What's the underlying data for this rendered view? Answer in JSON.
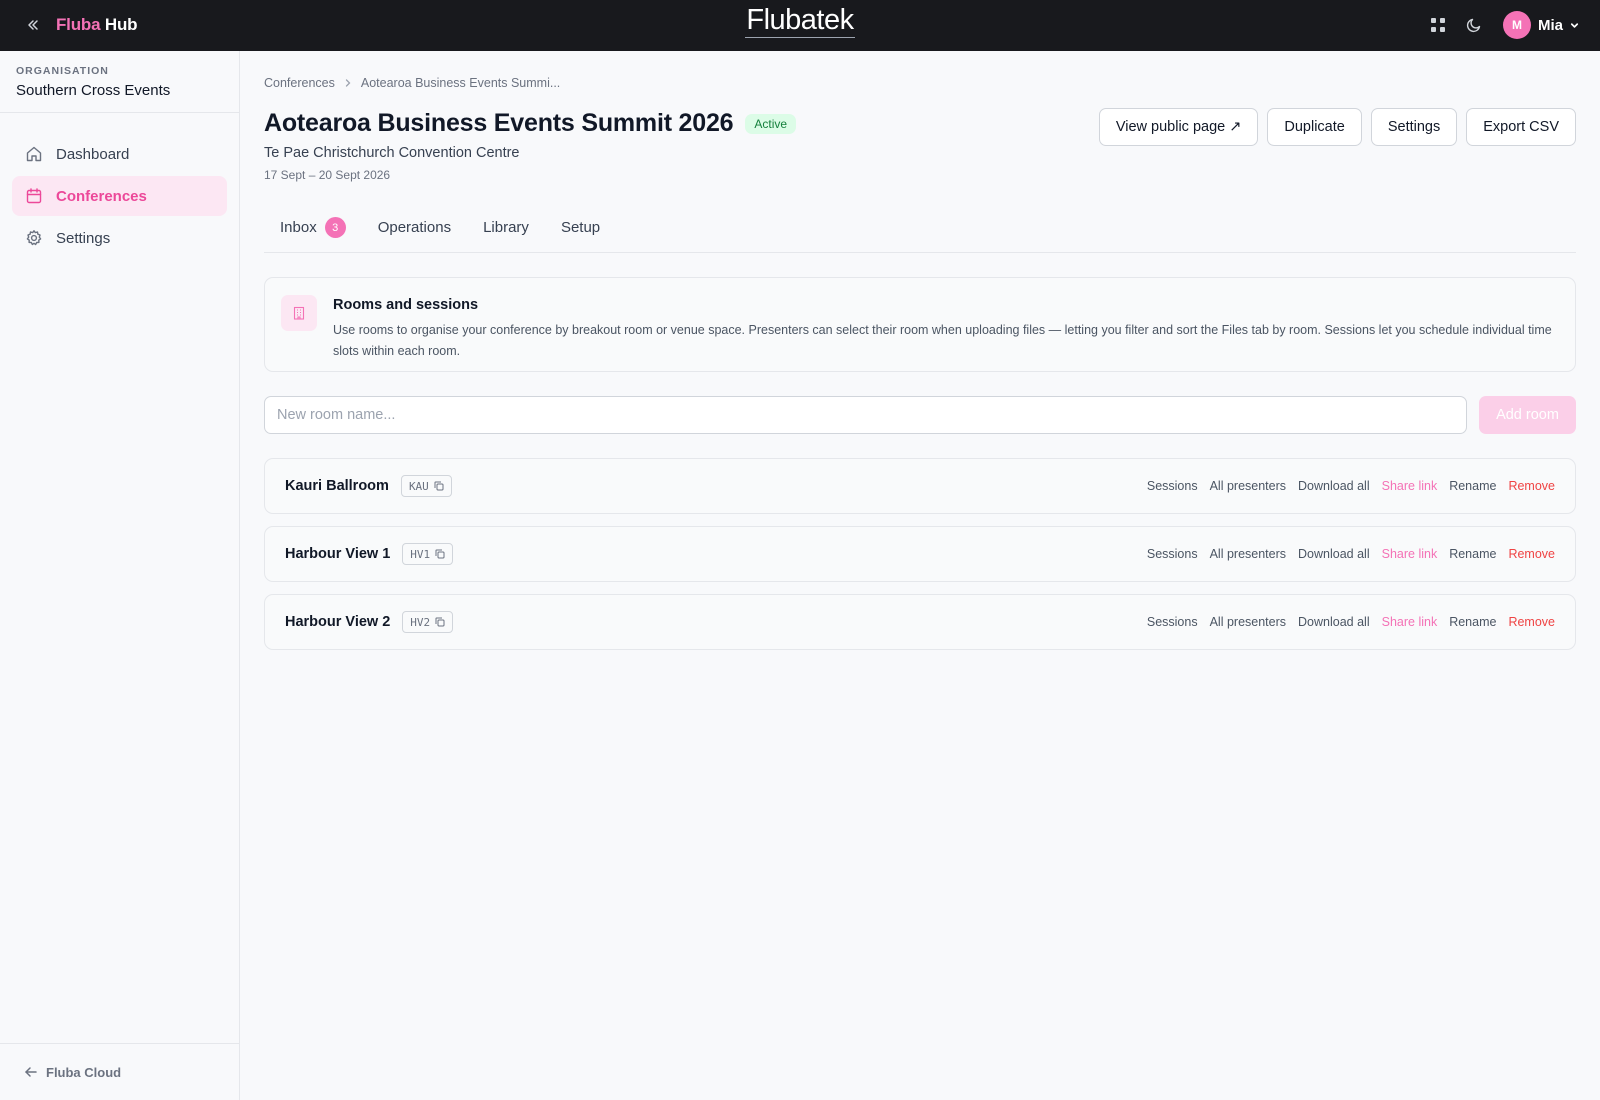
{
  "topbar": {
    "brand_part1": "Fluba",
    "brand_part2": "Hub",
    "logo": "Flubatek",
    "user_initial": "M",
    "user_name": "Mia",
    "icons": [
      "chevrons-left-icon",
      "grid-icon",
      "moon-icon",
      "chevron-down-icon"
    ]
  },
  "sidebar": {
    "org_label": "ORGANISATION",
    "org_name": "Southern Cross Events",
    "items": [
      {
        "label": "Dashboard",
        "icon": "home-icon",
        "active": false
      },
      {
        "label": "Conferences",
        "icon": "calendar-icon",
        "active": true
      },
      {
        "label": "Settings",
        "icon": "gear-icon",
        "active": false
      }
    ],
    "footer_label": "Fluba Cloud"
  },
  "breadcrumb": {
    "root": "Conferences",
    "current": "Aotearoa Business Events Summi..."
  },
  "conference": {
    "title": "Aotearoa Business Events Summit 2026",
    "status": "Active",
    "venue": "Te Pae Christchurch Convention Centre",
    "dates": "17 Sept – 20 Sept 2026"
  },
  "actions": {
    "view_public": "View public page ↗",
    "duplicate": "Duplicate",
    "settings": "Settings",
    "export": "Export CSV"
  },
  "tabs": [
    {
      "label": "Inbox",
      "badge": "3"
    },
    {
      "label": "Operations"
    },
    {
      "label": "Library"
    },
    {
      "label": "Setup"
    }
  ],
  "info": {
    "title": "Rooms and sessions",
    "text": "Use rooms to organise your conference by breakout room or venue space. Presenters can select their room when uploading files — letting you filter and sort the Files tab by room. Sessions let you schedule individual time slots within each room."
  },
  "add_room": {
    "placeholder": "New room name...",
    "button": "Add room"
  },
  "room_actions": {
    "sessions": "Sessions",
    "all_presenters": "All presenters",
    "download_all": "Download all",
    "share_link": "Share link",
    "rename": "Rename",
    "remove": "Remove"
  },
  "rooms": [
    {
      "name": "Kauri Ballroom",
      "code": "KAU"
    },
    {
      "name": "Harbour View 1",
      "code": "HV1"
    },
    {
      "name": "Harbour View 2",
      "code": "HV2"
    }
  ],
  "colors": {
    "accent": "#f472b6",
    "topbar": "#18191d",
    "active_green": "#15803d",
    "danger": "#ef4444"
  }
}
